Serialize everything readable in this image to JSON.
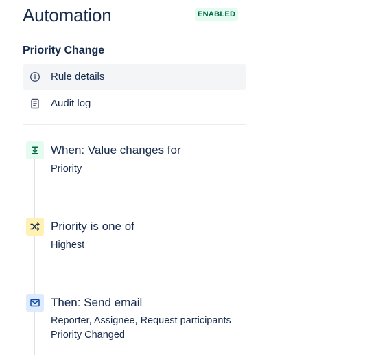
{
  "header": {
    "title": "Automation",
    "status": "ENABLED",
    "status_color": "#006644",
    "status_bg": "#e3fcef"
  },
  "rule": {
    "name": "Priority Change"
  },
  "nav": {
    "items": [
      {
        "label": "Rule details",
        "icon": "info-icon",
        "active": true
      },
      {
        "label": "Audit log",
        "icon": "document-icon",
        "active": false
      }
    ]
  },
  "steps": [
    {
      "kind": "trigger",
      "icon": "trigger-icon",
      "icon_bg": "#e3fcef",
      "icon_color": "#006644",
      "title": "When: Value changes for",
      "details": [
        "Priority"
      ]
    },
    {
      "kind": "condition",
      "icon": "shuffle-icon",
      "icon_bg": "#fff0b3",
      "icon_color": "#172b4d",
      "title": "Priority is one of",
      "details": [
        "Highest"
      ]
    },
    {
      "kind": "action",
      "icon": "email-icon",
      "icon_bg": "#deebff",
      "icon_color": "#0747a6",
      "title": "Then: Send email",
      "details": [
        "Reporter, Assignee, Request participants",
        "Priority Changed"
      ]
    }
  ]
}
